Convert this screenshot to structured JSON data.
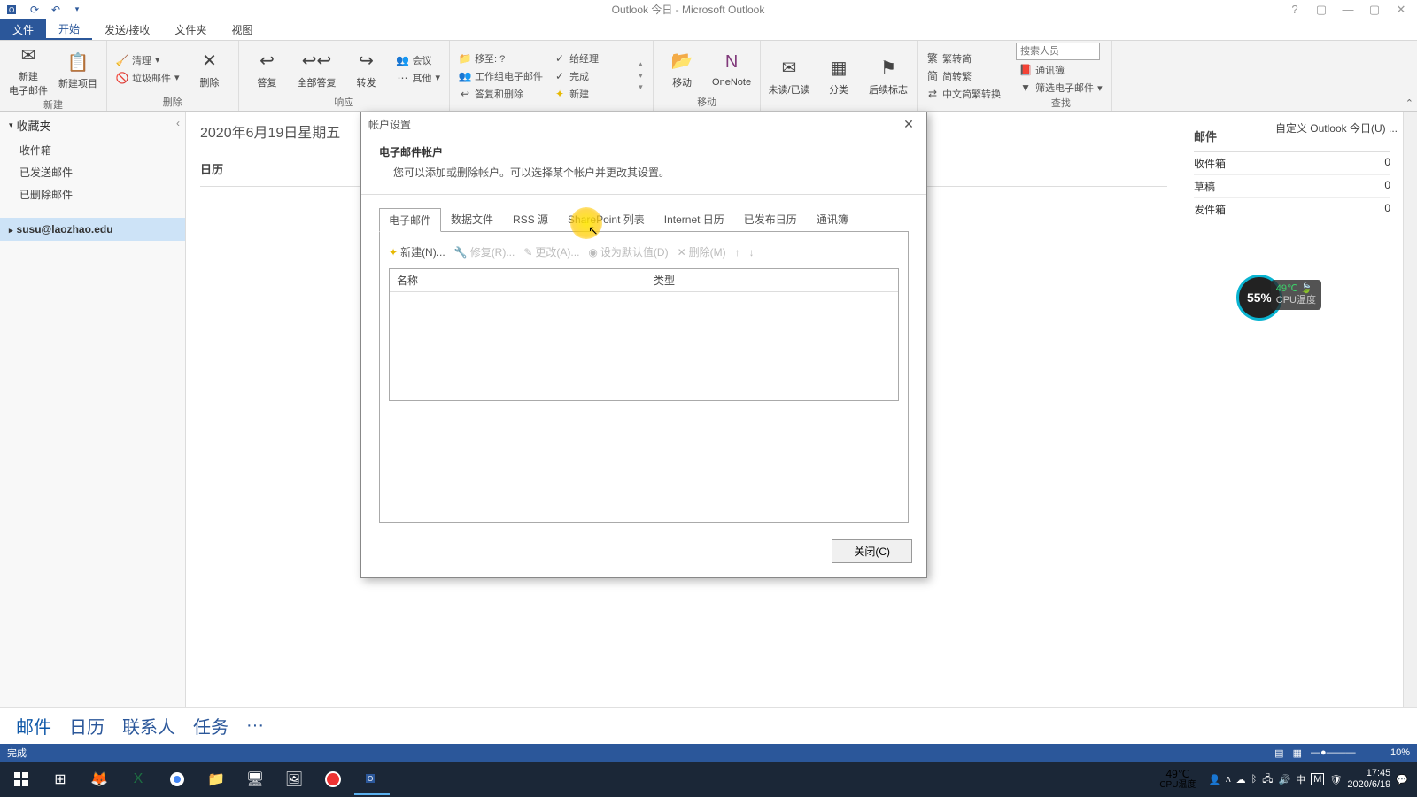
{
  "titlebar": {
    "title": "Outlook 今日 - Microsoft Outlook"
  },
  "ribbonTabs": {
    "file": "文件",
    "home": "开始",
    "sendreceive": "发送/接收",
    "folder": "文件夹",
    "view": "视图"
  },
  "ribbon": {
    "newmail": "新建\n电子邮件",
    "newitem": "新建项目",
    "group_new": "新建",
    "clean": "清理",
    "junk": "垃圾邮件",
    "delete": "删除",
    "group_delete": "删除",
    "reply": "答复",
    "replyall": "全部答复",
    "forward": "转发",
    "meeting": "会议",
    "more": "其他",
    "group_respond": "响应",
    "moveto": "移至: ?",
    "team": "工作组电子邮件",
    "replydelete": "答复和删除",
    "tomanager": "给经理",
    "done": "完成",
    "newquick": "新建",
    "move": "移动",
    "onenote": "OneNote",
    "group_move": "移动",
    "unread": "未读/已读",
    "categorize": "分类",
    "followup": "后续标志",
    "tosimplified": "繁转简",
    "totraditional": "简转繁",
    "cnconvert": "中文简繁转换",
    "searchplaceholder": "搜索人员",
    "addressbook": "通讯簿",
    "filter": "筛选电子邮件",
    "group_find": "查找"
  },
  "nav": {
    "favorites": "收藏夹",
    "inbox": "收件箱",
    "sent": "已发送邮件",
    "deleted": "已删除邮件",
    "account": "susu@laozhao.edu"
  },
  "today": {
    "date": "2020年6月19日星期五",
    "calendar": "日历",
    "customize": "自定义 Outlook 今日(U) ..."
  },
  "mailSummary": {
    "header": "邮件",
    "inbox": "收件箱",
    "inboxCount": "0",
    "drafts": "草稿",
    "draftsCount": "0",
    "outbox": "发件箱",
    "outboxCount": "0"
  },
  "navbar": {
    "mail": "邮件",
    "calendar": "日历",
    "contacts": "联系人",
    "tasks": "任务",
    "more": "···"
  },
  "statusbar": {
    "done": "完成",
    "zoom": "10%"
  },
  "dialog": {
    "title": "帐户设置",
    "heading": "电子邮件帐户",
    "desc": "您可以添加或删除帐户。可以选择某个帐户并更改其设置。",
    "tabs": {
      "email": "电子邮件",
      "datafiles": "数据文件",
      "rss": "RSS 源",
      "sharepoint": "SharePoint 列表",
      "internetcal": "Internet 日历",
      "publishedcal": "已发布日历",
      "addressbooks": "通讯簿"
    },
    "tools": {
      "new": "新建(N)...",
      "repair": "修复(R)...",
      "change": "更改(A)...",
      "default": "设为默认值(D)",
      "remove": "删除(M)"
    },
    "cols": {
      "name": "名称",
      "type": "类型"
    },
    "close": "关闭(C)"
  },
  "cpu": {
    "pct": "55%",
    "temp": "49℃",
    "label": "CPU温度"
  },
  "taskbar": {
    "temp": "49℃",
    "templabel": "CPU温度",
    "time": "17:45",
    "date": "2020/6/19"
  }
}
